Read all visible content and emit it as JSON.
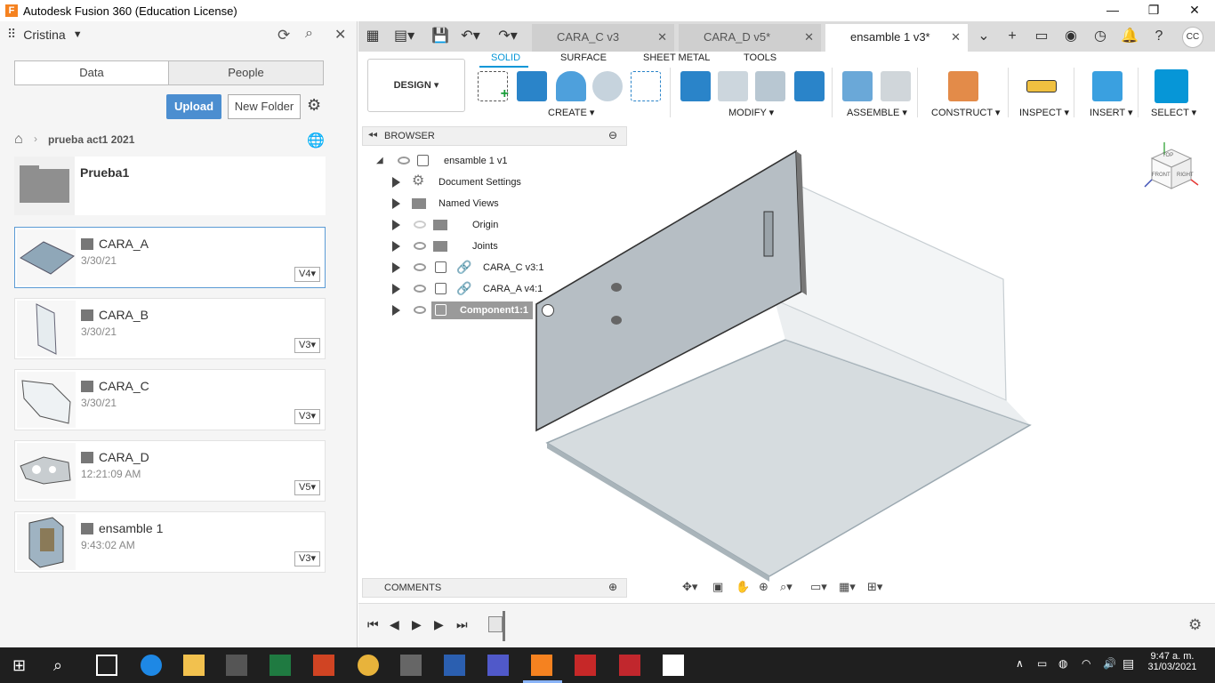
{
  "window": {
    "title": "Autodesk Fusion 360 (Education License)",
    "logo": "F"
  },
  "left_panel": {
    "user": "Cristina",
    "tabs": [
      "Data",
      "People"
    ],
    "upload_label": "Upload",
    "new_folder_label": "New Folder",
    "breadcrumb": "prueba act1 2021",
    "items": [
      {
        "name": "Prueba1",
        "date": "",
        "version": ""
      },
      {
        "name": "CARA_A",
        "date": "3/30/21",
        "version": "V4"
      },
      {
        "name": "CARA_B",
        "date": "3/30/21",
        "version": "V3"
      },
      {
        "name": "CARA_C",
        "date": "3/30/21",
        "version": "V3"
      },
      {
        "name": "CARA_D",
        "date": "12:21:09 AM",
        "version": "V5"
      },
      {
        "name": "ensamble 1",
        "date": "9:43:02 AM",
        "version": "V3"
      }
    ]
  },
  "doc_tabs": [
    {
      "label": "CARA_C v3"
    },
    {
      "label": "CARA_D v5*"
    },
    {
      "label": "ensamble 1 v3*"
    }
  ],
  "user_initials": "CC",
  "ribbon": {
    "workspace": "DESIGN",
    "tabs": [
      "SOLID",
      "SURFACE",
      "SHEET METAL",
      "TOOLS"
    ],
    "groups": [
      "CREATE",
      "MODIFY",
      "ASSEMBLE",
      "CONSTRUCT",
      "INSPECT",
      "INSERT",
      "SELECT"
    ]
  },
  "browser": {
    "title": "BROWSER",
    "root": "ensamble 1 v1",
    "items": [
      "Document Settings",
      "Named Views",
      "Origin",
      "Joints",
      "CARA_C v3:1",
      "CARA_A v4:1",
      "Component1:1"
    ]
  },
  "comments_label": "COMMENTS",
  "viewcube": {
    "top": "TOP",
    "front": "FRONT",
    "right": "RIGHT"
  },
  "taskbar": {
    "time": "9:47 a. m.",
    "date": "31/03/2021"
  }
}
